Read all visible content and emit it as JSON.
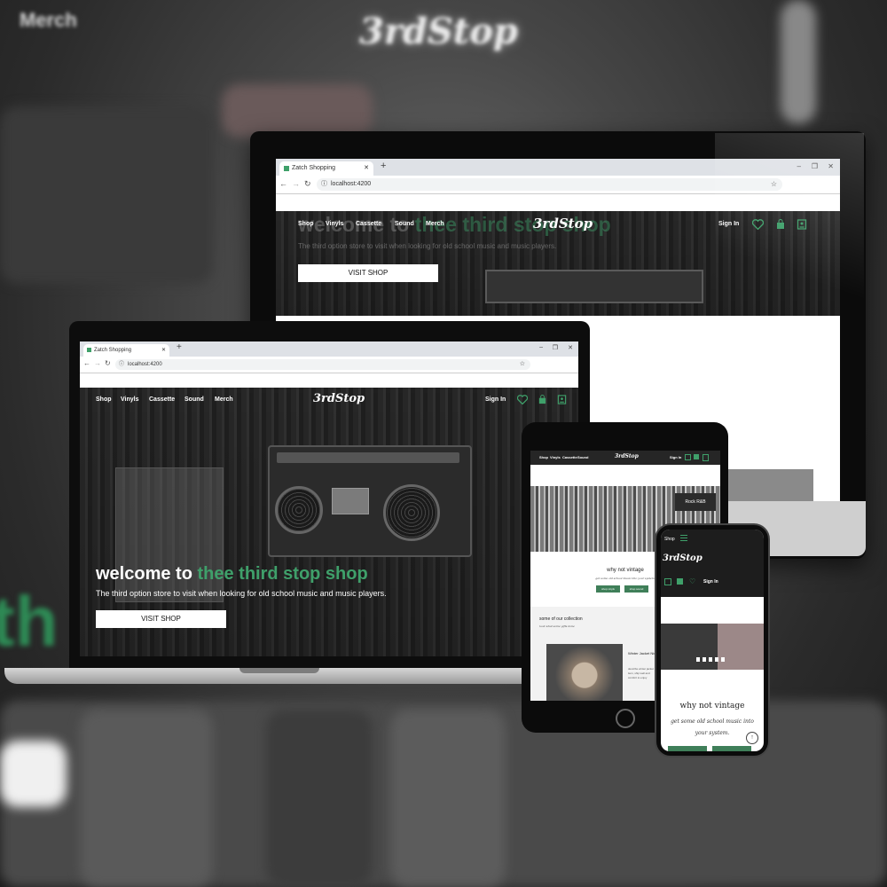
{
  "background": {
    "merch_text": "Merch",
    "logo_text": "3rdStop",
    "partial_text": "th"
  },
  "site": {
    "nav_links": [
      "Shop",
      "Vinyls",
      "Cassette",
      "Sound",
      "Merch"
    ],
    "logo": "3rdStop",
    "sign_in": "Sign In",
    "hero_title_white": "welcome to ",
    "hero_title_green": "thee third stop shop",
    "hero_subtitle": "The third option store to visit when looking for old school music and music players.",
    "visit_button": "VISIT SHOP",
    "accent_color": "#3fa06a"
  },
  "browser": {
    "tab_title": "Zatch Shopping",
    "new_tab": "+",
    "url": "localhost:4200",
    "window_controls": [
      "–",
      "❐",
      "✕"
    ]
  },
  "tablet": {
    "why_title": "why not vintage",
    "why_sub": "get some old school music into your system.",
    "btn_left": "shop vinyls",
    "btn_right": "shop sound",
    "collection_title": "some of our collection",
    "collection_sub": "look what some gifts done",
    "product_name": "Winter Jacket Nixel",
    "product_desc": "describe winter jacket item, ship well and comfort to enjoy"
  },
  "phone": {
    "shop_label": "Shop",
    "logo": "3rdStop",
    "sign_in": "Sign In",
    "why_title": "why not vintage",
    "why_sub": "get some old school music into your system."
  }
}
